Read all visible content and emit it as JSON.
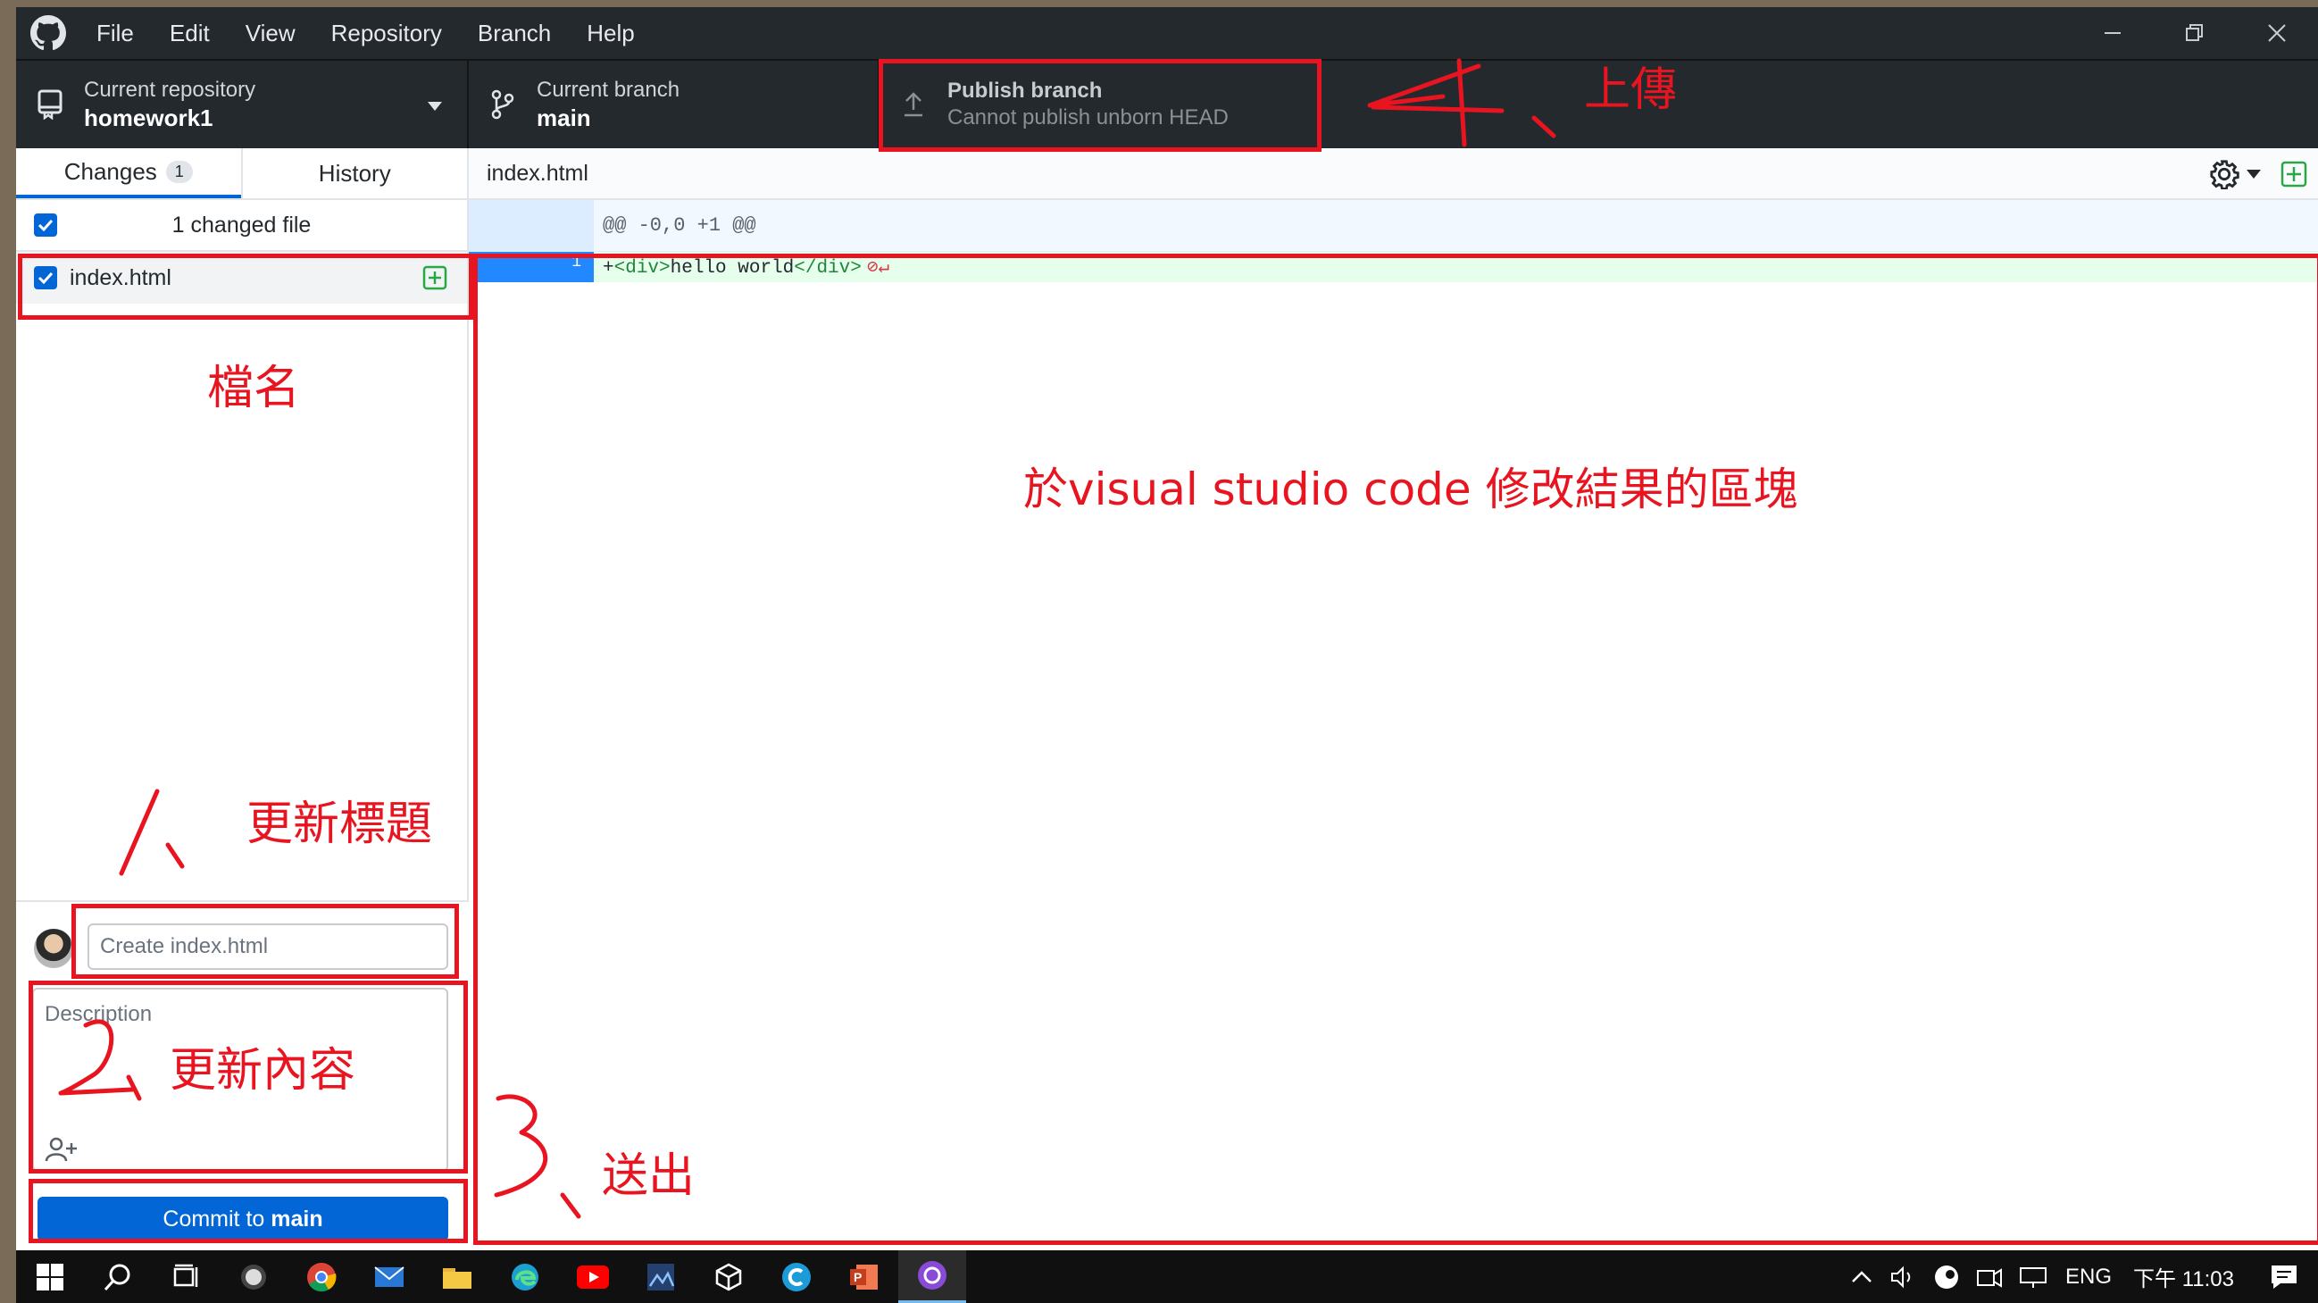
{
  "menu": {
    "file": "File",
    "edit": "Edit",
    "view": "View",
    "repository": "Repository",
    "branch": "Branch",
    "help": "Help"
  },
  "toolbar": {
    "repo_label": "Current repository",
    "repo_value": "homework1",
    "branch_label": "Current branch",
    "branch_value": "main",
    "publish_label": "Publish branch",
    "publish_value": "Cannot publish unborn HEAD"
  },
  "sidebar": {
    "tab_changes": "Changes",
    "changes_count": "1",
    "tab_history": "History",
    "changed_files_text": "1 changed file",
    "files": [
      {
        "name": "index.html"
      }
    ]
  },
  "commit": {
    "summary_placeholder": "Create index.html",
    "description_placeholder": "Description",
    "button_prefix": "Commit to ",
    "button_branch": "main"
  },
  "diff": {
    "file_name": "index.html",
    "hunk_header": "@@ -0,0 +1 @@",
    "line_number": "1",
    "line_plus": "+",
    "line_tag_open": "<div>",
    "line_text": "hello world",
    "line_tag_close": "</div>",
    "line_eol": "⊘↵"
  },
  "annotations": {
    "upload": "上傳",
    "filename": "檔名",
    "vscode_area": "於visual studio code 修改結果的區塊",
    "update_title": "更新標題",
    "update_content": "更新內容",
    "send": "送出"
  },
  "taskbar": {
    "language": "ENG",
    "clock": "下午 11:03"
  },
  "colors": {
    "titlebar": "#24292e",
    "accent": "#0366d6",
    "annotation_red": "#e8141f",
    "diff_added": "#e6ffed"
  }
}
